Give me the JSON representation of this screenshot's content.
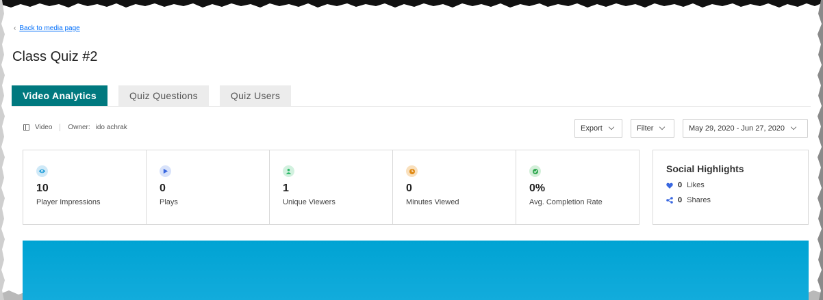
{
  "colors": {
    "tab_active_bg": "#00797f",
    "link": "#006efa",
    "banner": "#00a3d3",
    "impressions_icon": "#1a9bd8",
    "plays_icon": "#3a68e0",
    "viewers_icon": "#2fb86a",
    "minutes_icon": "#e08a14",
    "completion_icon": "#2fa84f",
    "heart": "#3a68e0"
  },
  "nav": {
    "back_label": "Back to media page"
  },
  "page": {
    "title": "Class Quiz #2"
  },
  "tabs": [
    {
      "label": "Video Analytics",
      "active": true
    },
    {
      "label": "Quiz Questions",
      "active": false
    },
    {
      "label": "Quiz Users",
      "active": false
    }
  ],
  "meta": {
    "type": "Video",
    "owner_label": "Owner:",
    "owner_name": "ido achrak"
  },
  "toolbar": {
    "export_label": "Export",
    "filter_label": "Filter",
    "date_range": "May 29, 2020 - Jun 27, 2020"
  },
  "stats": [
    {
      "icon": "eye-icon",
      "value": "10",
      "label": "Player Impressions"
    },
    {
      "icon": "play-icon",
      "value": "0",
      "label": "Plays"
    },
    {
      "icon": "person-icon",
      "value": "1",
      "label": "Unique Viewers"
    },
    {
      "icon": "clock-icon",
      "value": "0",
      "label": "Minutes Viewed"
    },
    {
      "icon": "check-icon",
      "value": "0%",
      "label": "Avg. Completion Rate"
    }
  ],
  "social": {
    "title": "Social Highlights",
    "likes_value": "0",
    "likes_label": "Likes",
    "shares_value": "0",
    "shares_label": "Shares"
  }
}
